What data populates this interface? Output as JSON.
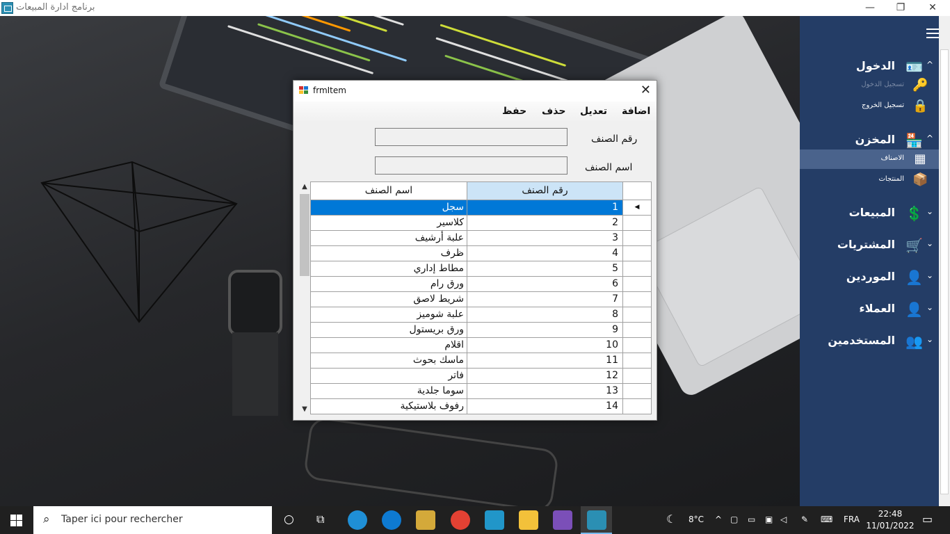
{
  "window": {
    "title": "برنامج ادارة المبيعات",
    "minimize": "—",
    "maximize": "❐",
    "close": "✕"
  },
  "form": {
    "title": "frmItem",
    "close": "✕",
    "menu": {
      "add": "اضافة",
      "edit": "تعديل",
      "delete": "حذف",
      "save": "حفظ"
    },
    "fields": {
      "item_number_label": "رقم الصنف",
      "item_name_label": "اسم الصنف",
      "item_number_value": "",
      "item_name_value": ""
    },
    "grid": {
      "col_name": "اسم الصنف",
      "col_number": "رقم الصنف",
      "rows": [
        {
          "number": "1",
          "name": "سجل"
        },
        {
          "number": "2",
          "name": "كلاسير"
        },
        {
          "number": "3",
          "name": "علبة أرشيف"
        },
        {
          "number": "4",
          "name": "ظرف"
        },
        {
          "number": "5",
          "name": "مطاط إداري"
        },
        {
          "number": "6",
          "name": "ورق رام"
        },
        {
          "number": "7",
          "name": "شريط لاصق"
        },
        {
          "number": "8",
          "name": "علبة شوميز"
        },
        {
          "number": "9",
          "name": "ورق بريستول"
        },
        {
          "number": "10",
          "name": "اقلام"
        },
        {
          "number": "11",
          "name": "ماسك بحوث"
        },
        {
          "number": "12",
          "name": "فاتر"
        },
        {
          "number": "13",
          "name": "سوما جلدية"
        },
        {
          "number": "14",
          "name": "رفوف بلاستيكية"
        }
      ]
    }
  },
  "sidebar": {
    "sections": [
      {
        "label": "الدخول",
        "icon": "id-card-icon",
        "glyph": "🪪",
        "chevron": "^"
      },
      {
        "label": "المخزن",
        "icon": "store-icon",
        "glyph": "🏪",
        "chevron": "^"
      },
      {
        "label": "المبيعات",
        "icon": "sales-icon",
        "glyph": "💲",
        "chevron": "⌄"
      },
      {
        "label": "المشتريات",
        "icon": "cart-icon",
        "glyph": "🛒",
        "chevron": "⌄"
      },
      {
        "label": "الموردين",
        "icon": "supplier-icon",
        "glyph": "👤",
        "chevron": "⌄"
      },
      {
        "label": "العملاء",
        "icon": "customer-icon",
        "glyph": "👤",
        "chevron": "⌄"
      },
      {
        "label": "المستخدمين",
        "icon": "users-icon",
        "glyph": "👥",
        "chevron": "⌄"
      }
    ],
    "sub": {
      "login": "تسجيل الدخول",
      "logout": "تسجيل الخروج",
      "items": "الاصناف",
      "products": "المنتجات"
    }
  },
  "taskbar": {
    "search_placeholder": "Taper ici pour rechercher",
    "temperature": "8°C",
    "language": "FRA",
    "time": "22:48",
    "date": "11/01/2022"
  },
  "colors": {
    "sidebar_bg": "#243d66",
    "sidebar_active": "#4a638c",
    "selection": "#0078d7",
    "header_selected": "#cce4f7"
  }
}
